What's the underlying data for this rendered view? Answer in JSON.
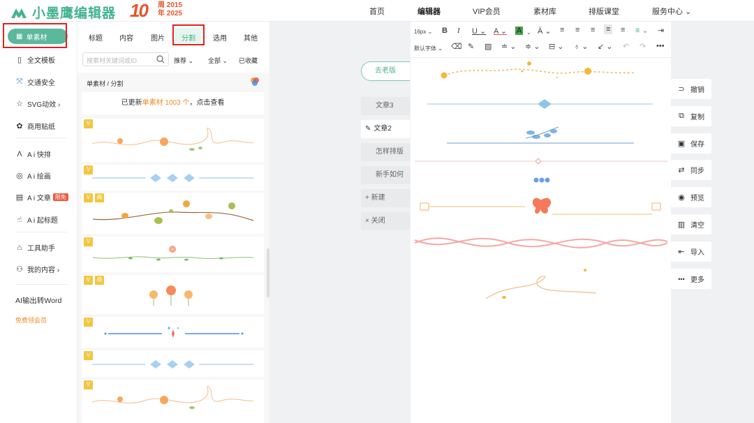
{
  "brand": {
    "name": "小墨鹰编辑器",
    "anniversary_number": "10",
    "anniversary_line1": "周 2015",
    "anniversary_line2": "年 2025"
  },
  "topnav": [
    {
      "label": "首页"
    },
    {
      "label": "编辑器"
    },
    {
      "label": "VIP会员"
    },
    {
      "label": "素材库"
    },
    {
      "label": "排版课堂"
    },
    {
      "label": "服务中心 ⌄"
    }
  ],
  "leftnav": {
    "active": "单素材",
    "items": [
      {
        "label": "全文模板",
        "icon": "layout-icon"
      },
      {
        "label": "交通安全",
        "icon": "traffic-icon"
      },
      {
        "label": "SVG动效 ›",
        "icon": "star-icon"
      },
      {
        "label": "商用贴纸",
        "icon": "sticker-icon"
      },
      {
        "label": "A i 快排",
        "icon": "ai-icon"
      },
      {
        "label": "A i 绘画",
        "icon": "palette-icon"
      },
      {
        "label": "A i 文章",
        "icon": "doc-icon",
        "badge": "限免"
      },
      {
        "label": "A i 起标题",
        "icon": "hand-icon"
      },
      {
        "label": "工具助手",
        "icon": "tool-icon"
      },
      {
        "label": "我的内容 ›",
        "icon": "user-icon"
      }
    ],
    "word_export": "AI输出转Word",
    "free_vip": "免费领会员"
  },
  "panel": {
    "tabs": [
      {
        "label": "标题"
      },
      {
        "label": "内容"
      },
      {
        "label": "图片"
      },
      {
        "label": "分割"
      },
      {
        "label": "选用"
      },
      {
        "label": "其他"
      }
    ],
    "search_placeholder": "搜索材关键词或ID",
    "filters": [
      "推荐 ⌄",
      "全部 ⌄",
      "已收藏"
    ],
    "breadcrumb": "单素材 / 分割",
    "update_prefix": "已更新",
    "update_highlight": "单素材 1003 个",
    "update_suffix": "，点击查看",
    "vip_mark": "V",
    "shang_mark": "商"
  },
  "articles": {
    "old_version": "去老版",
    "items": [
      "文章3",
      "文章2",
      "怎样排版",
      "新手如何",
      "+ 新建",
      "× 关闭"
    ]
  },
  "toolbar": {
    "font_size": "16px",
    "default_font": "默认字体"
  },
  "right_tools": [
    {
      "label": "撤销",
      "icon": "undo-icon",
      "glyph": "⊃"
    },
    {
      "label": "复制",
      "icon": "copy-icon",
      "glyph": "⧉"
    },
    {
      "label": "保存",
      "icon": "save-icon",
      "glyph": "▣"
    },
    {
      "label": "同步",
      "icon": "sync-icon",
      "glyph": "⇄"
    },
    {
      "label": "预览",
      "icon": "eye-icon",
      "glyph": "◉"
    },
    {
      "label": "清空",
      "icon": "trash-icon",
      "glyph": "🗑"
    },
    {
      "label": "导入",
      "icon": "import-icon",
      "glyph": "⇤"
    },
    {
      "label": "更多",
      "icon": "more-icon",
      "glyph": "•••"
    }
  ],
  "colors": {
    "accent": "#43b48f",
    "orange": "#f4a93c",
    "blue": "#7fb3e6"
  }
}
